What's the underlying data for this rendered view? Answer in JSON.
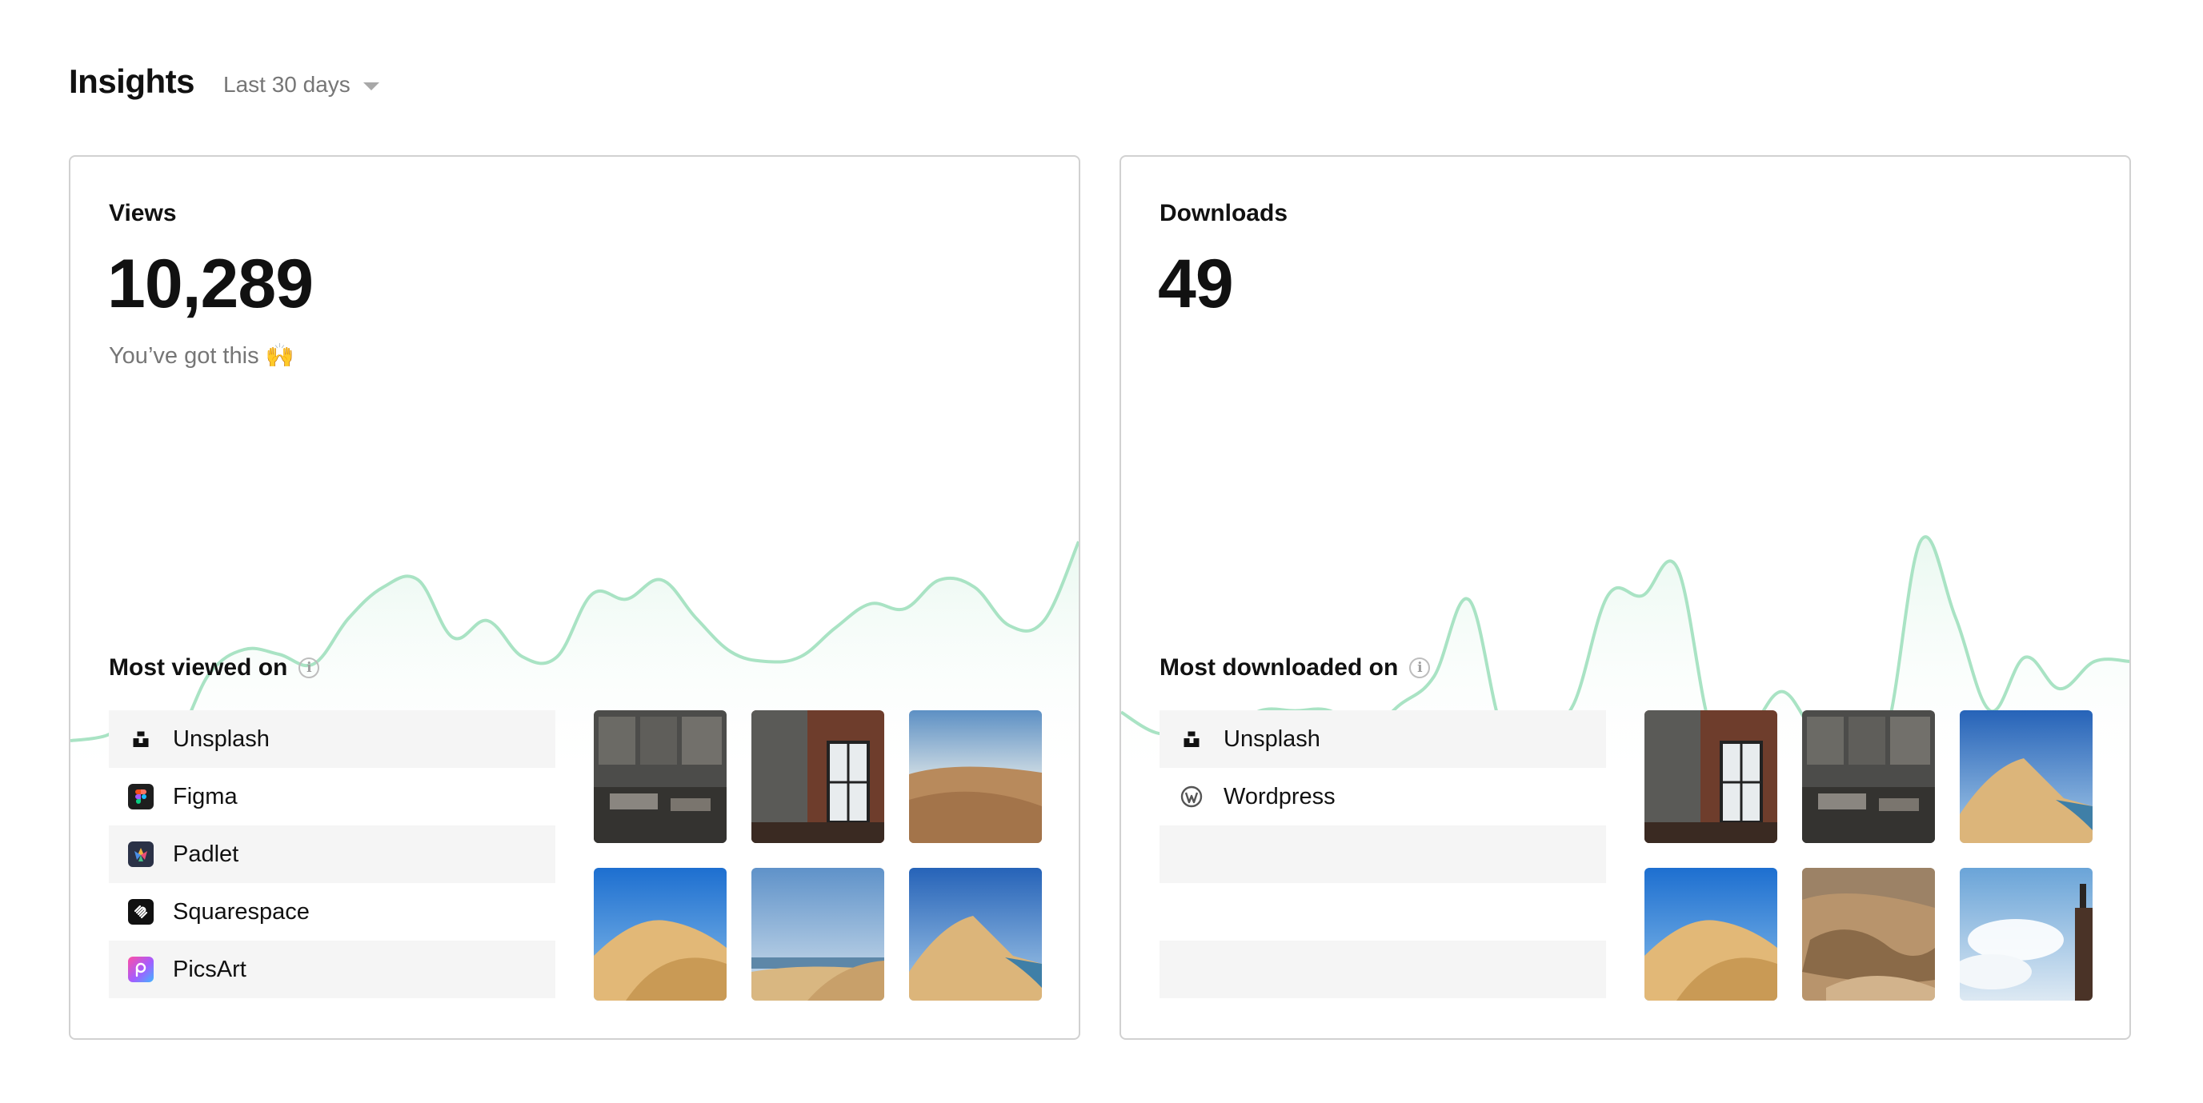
{
  "header": {
    "title": "Insights",
    "range_label": "Last 30 days"
  },
  "views": {
    "label": "Views",
    "value": "10,289",
    "subtitle": "You’ve got this 🙌",
    "section_title": "Most viewed on",
    "platforms": [
      {
        "name": "Unsplash",
        "icon": "unsplash-icon"
      },
      {
        "name": "Figma",
        "icon": "figma-icon"
      },
      {
        "name": "Padlet",
        "icon": "padlet-icon"
      },
      {
        "name": "Squarespace",
        "icon": "squarespace-icon"
      },
      {
        "name": "PicsArt",
        "icon": "picsart-icon"
      }
    ],
    "thumbnails": [
      "industrial-interior",
      "brick-window-interior",
      "desert-dunes",
      "sand-dune-blue-sky",
      "coastal-dunes",
      "dune-ridge-ocean"
    ]
  },
  "downloads": {
    "label": "Downloads",
    "value": "49",
    "section_title": "Most downloaded on",
    "platforms": [
      {
        "name": "Unsplash",
        "icon": "unsplash-icon"
      },
      {
        "name": "Wordpress",
        "icon": "wordpress-icon"
      },
      {
        "name": "",
        "icon": ""
      },
      {
        "name": "",
        "icon": ""
      },
      {
        "name": "",
        "icon": ""
      }
    ],
    "thumbnails": [
      "brick-window-interior",
      "industrial-interior",
      "dune-ridge-ocean",
      "sand-dune-blue-sky",
      "canyon-aerial",
      "cliff-clouds"
    ]
  },
  "colors": {
    "spark_line": "#a9e3c4",
    "spark_fill": "#e9f8f0",
    "row_shade": "#f5f5f5"
  },
  "chart_data": [
    {
      "type": "area",
      "name": "views-trend",
      "x": [
        0,
        1,
        2,
        3,
        4,
        5,
        6,
        7,
        8,
        9,
        10,
        11,
        12,
        13,
        14,
        15,
        16,
        17,
        18,
        19,
        20,
        21,
        22,
        23,
        24,
        25,
        26,
        27,
        28,
        29
      ],
      "values": [
        10,
        12,
        19,
        11,
        38,
        48,
        46,
        42,
        61,
        74,
        77,
        53,
        60,
        45,
        45,
        71,
        69,
        77,
        61,
        47,
        43,
        45,
        57,
        67,
        65,
        77,
        74,
        58,
        60,
        93
      ]
    },
    {
      "type": "area",
      "name": "downloads-trend",
      "x": [
        0,
        1,
        2,
        3,
        4,
        5,
        6,
        7,
        8,
        9,
        10,
        11,
        12,
        13,
        14,
        15,
        16,
        17,
        18,
        19,
        20,
        21,
        22,
        23,
        24,
        25,
        26,
        27,
        28,
        29
      ],
      "values": [
        15,
        0,
        0,
        0,
        16,
        16,
        16,
        0,
        20,
        41,
        97,
        0,
        0,
        20,
        100,
        100,
        120,
        0,
        0,
        30,
        0,
        0,
        0,
        140,
        84,
        16,
        55,
        32,
        52,
        52
      ]
    }
  ]
}
